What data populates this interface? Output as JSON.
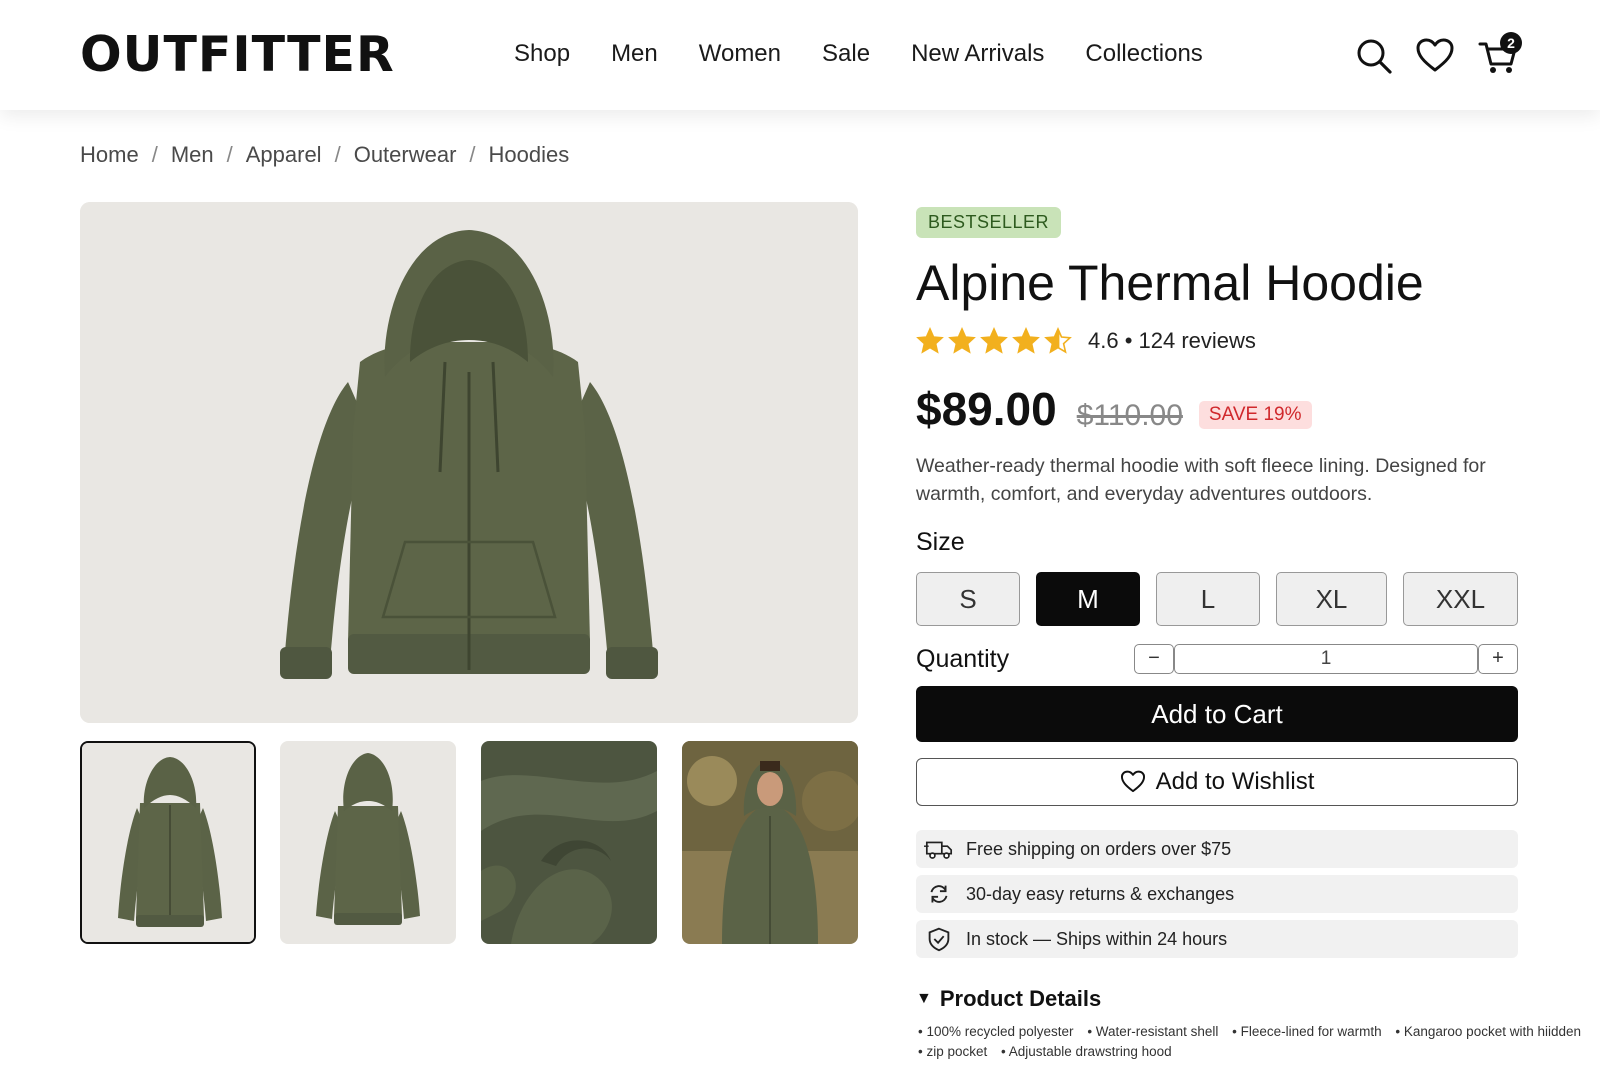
{
  "header": {
    "logo": "OUTFITTER",
    "nav": [
      "Shop",
      "Men",
      "Women",
      "Sale",
      "New Arrivals",
      "Collections"
    ],
    "cart_count": "2",
    "icons": [
      "search-icon",
      "heart-icon",
      "cart-icon"
    ]
  },
  "breadcrumb": [
    "Home",
    "Men",
    "Apparel",
    "Outerwear",
    "Hoodies"
  ],
  "product": {
    "badge": "BESTSELLER",
    "title": "Alpine Thermal Hoodie",
    "rating": 4.6,
    "rating_text": "4.6 • 124 reviews",
    "price": "$89.00",
    "old_price": "$110.00",
    "save": "SAVE 19%",
    "description": "Weather-ready thermal hoodie with soft fleece lining. Designed for warmth, comfort, and everyday adventures outdoors.",
    "size_label": "Size",
    "sizes": [
      "S",
      "M",
      "L",
      "XL",
      "XXL"
    ],
    "selected_size": "M",
    "quantity_label": "Quantity",
    "quantity": "1",
    "qty_minus": "−",
    "qty_plus": "+",
    "add_to_cart": "Add to Cart",
    "add_to_wishlist": "Add to Wishlist",
    "perks": [
      "Free shipping on orders over $75",
      "30-day easy returns & exchanges",
      "In stock — Ships within 24 hours"
    ],
    "details_title": "Product Details",
    "details": [
      "• 100% recycled polyester",
      "• Water-resistant shell",
      "• Fleece-lined for warmth",
      "• Kangaroo pocket with hiidden",
      "• zip pocket",
      "• Adjustable drawstring hood"
    ]
  },
  "colors": {
    "badge_bg": "#c9e3b8",
    "badge_text": "#2d5a1e",
    "save_bg": "#fddede",
    "save_text": "#d0282c",
    "star": "#f2b01e",
    "hoodie": "#5b6347"
  }
}
